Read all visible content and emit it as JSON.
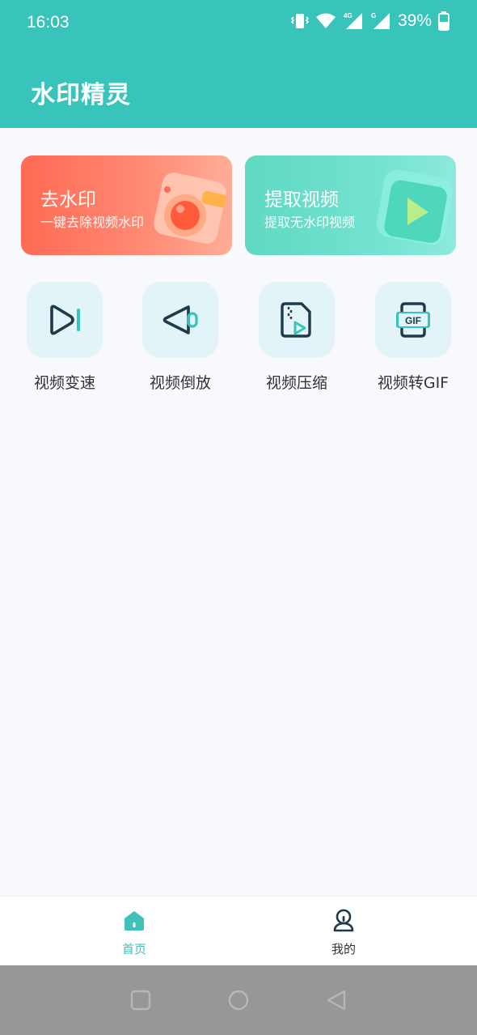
{
  "status_bar": {
    "time": "16:03",
    "battery": "39%",
    "net1": "4G",
    "net2": "G"
  },
  "app": {
    "title": "水印精灵"
  },
  "cards": [
    {
      "title": "去水印",
      "subtitle": "一键去除视频水印"
    },
    {
      "title": "提取视频",
      "subtitle": "提取无水印视频"
    }
  ],
  "tools": [
    {
      "label": "视频变速",
      "icon": "video-speed-icon"
    },
    {
      "label": "视频倒放",
      "icon": "video-reverse-icon"
    },
    {
      "label": "视频压缩",
      "icon": "video-compress-icon"
    },
    {
      "label": "视频转GIF",
      "icon": "video-to-gif-icon",
      "icon_text": "GIF"
    }
  ],
  "bottom_nav": [
    {
      "label": "首页",
      "icon": "home-icon",
      "active": true
    },
    {
      "label": "我的",
      "icon": "profile-icon",
      "active": false
    }
  ],
  "colors": {
    "primary": "#38c3bb",
    "card_red": "#ff6a55",
    "card_green": "#5fd9c2",
    "tool_bg": "#e2f4f7",
    "icon_dark": "#1f3a4a"
  }
}
